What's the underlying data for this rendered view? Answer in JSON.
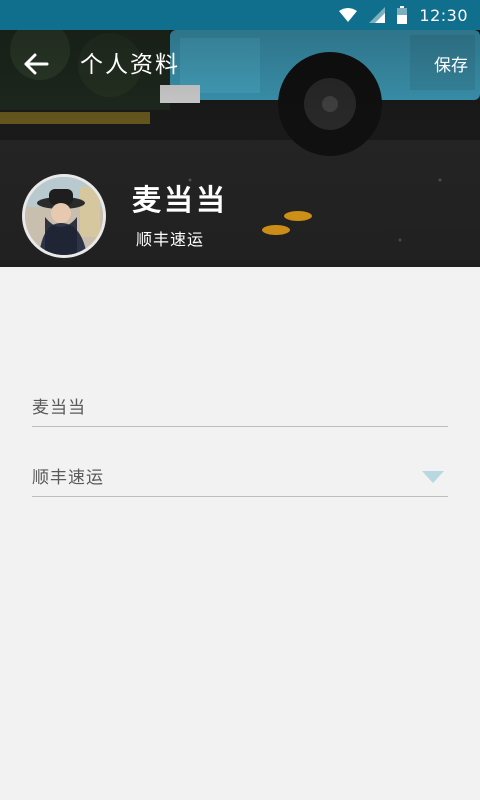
{
  "status_bar": {
    "time": "12:30",
    "icons": [
      "wifi-icon",
      "cell-signal-icon",
      "battery-icon"
    ],
    "background_color": "#0f6f8c"
  },
  "header": {
    "title": "个人资料",
    "save_label": "保存",
    "back_icon": "arrow-left-icon"
  },
  "profile": {
    "name": "麦当当",
    "company": "顺丰速运"
  },
  "form": {
    "name_value": "麦当当",
    "company_value": "顺丰速运",
    "company_dropdown_icon": "triangle-down-icon",
    "accent_color": "#b7d8e0"
  }
}
